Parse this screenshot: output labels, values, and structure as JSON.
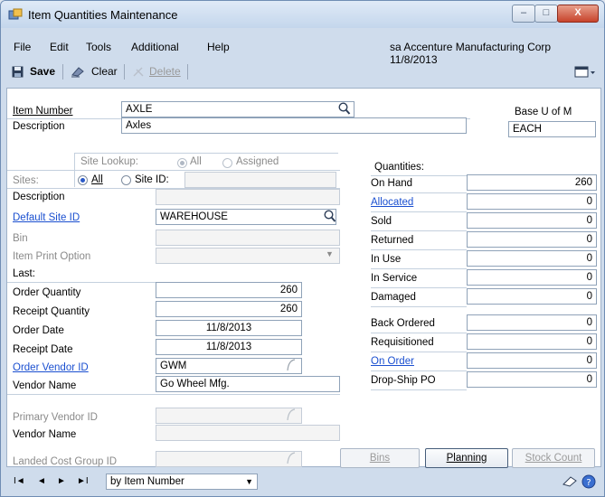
{
  "window": {
    "title": "Item Quantities Maintenance",
    "controls": {
      "minimize": "–",
      "maximize": "□",
      "close": "X"
    }
  },
  "menu": {
    "items": [
      "File",
      "Edit",
      "Tools",
      "Additional",
      "Help"
    ],
    "company_info": "sa  Accenture Manufacturing Corp  11/8/2013"
  },
  "toolbar": {
    "save_label": "Save",
    "clear_label": "Clear",
    "delete_label": "Delete"
  },
  "item": {
    "number_label": "Item Number",
    "number_value": "AXLE",
    "description_label": "Description",
    "description_value": "Axles",
    "base_uom_label": "Base U of M",
    "base_uom_value": "EACH"
  },
  "sites": {
    "lookup_label": "Site Lookup:",
    "lookup_all": "All",
    "lookup_assigned": "Assigned",
    "sites_label": "Sites:",
    "all_option": "All",
    "site_id_option": "Site ID:",
    "description_label": "Description",
    "default_site_label": "Default Site ID",
    "default_site_value": "WAREHOUSE",
    "bin_label": "Bin",
    "print_option_label": "Item Print Option"
  },
  "last": {
    "header": "Last:",
    "rows": [
      {
        "label": "Order Quantity",
        "value": "260"
      },
      {
        "label": "Receipt Quantity",
        "value": "260"
      },
      {
        "label": "Order Date",
        "value": "11/8/2013"
      },
      {
        "label": "Receipt Date",
        "value": "11/8/2013"
      }
    ],
    "order_vendor_label": "Order Vendor ID",
    "order_vendor_value": "GWM",
    "vendor_name_label": "Vendor Name",
    "vendor_name_value": "Go Wheel Mfg.",
    "primary_vendor_label": "Primary Vendor ID",
    "primary_vendor_name_label": "Vendor Name",
    "landed_cost_label": "Landed Cost Group ID"
  },
  "quantities": {
    "header": "Quantities:",
    "rows": [
      {
        "label": "On Hand",
        "value": "260",
        "link": false
      },
      {
        "label": "Allocated",
        "value": "0",
        "link": true
      },
      {
        "label": "Sold",
        "value": "0",
        "link": false
      },
      {
        "label": "Returned",
        "value": "0",
        "link": false
      },
      {
        "label": "In Use",
        "value": "0",
        "link": false
      },
      {
        "label": "In Service",
        "value": "0",
        "link": false
      },
      {
        "label": "Damaged",
        "value": "0",
        "link": false
      }
    ],
    "rows2": [
      {
        "label": "Back Ordered",
        "value": "0",
        "link": false
      },
      {
        "label": "Requisitioned",
        "value": "0",
        "link": false
      },
      {
        "label": "On Order",
        "value": "0",
        "link": true
      },
      {
        "label": "Drop-Ship PO",
        "value": "0",
        "link": false
      }
    ]
  },
  "buttons": {
    "bins": "Bins",
    "planning": "Planning",
    "stock_count": "Stock Count"
  },
  "navigation": {
    "first": "I◄",
    "prev": "◄",
    "next": "►",
    "last": "►I",
    "sort_value": "by Item Number"
  },
  "colors": {
    "link": "#1a4fd0",
    "window_frame": "#cfdcec",
    "title_gradient_top": "#dfeaf7"
  }
}
